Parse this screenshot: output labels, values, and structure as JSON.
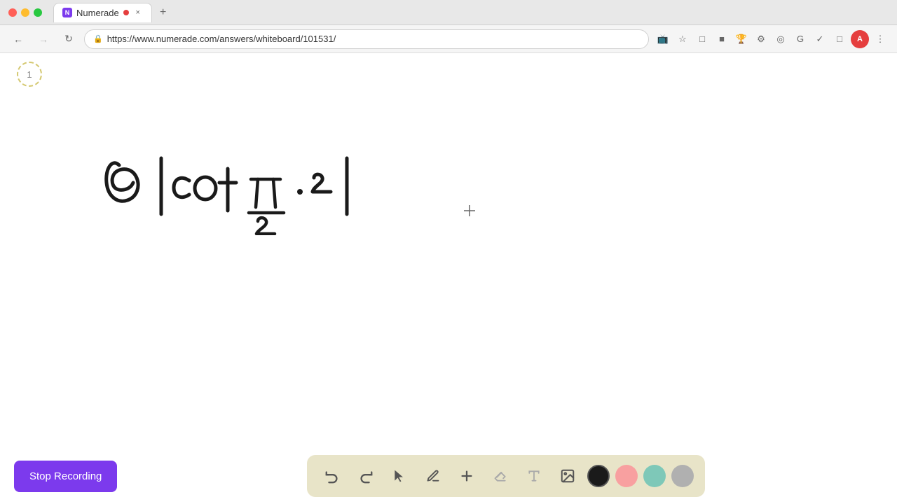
{
  "browser": {
    "tab_title": "Numerade",
    "tab_favicon": "N",
    "url": "https://www.numerade.com/answers/whiteboard/101531/",
    "recording_dot": true
  },
  "page": {
    "number": "1"
  },
  "toolbar": {
    "stop_recording_label": "Stop Recording",
    "tools": [
      {
        "id": "undo",
        "icon": "↩",
        "label": "Undo"
      },
      {
        "id": "redo",
        "icon": "↪",
        "label": "Redo"
      },
      {
        "id": "select",
        "icon": "▲",
        "label": "Select"
      },
      {
        "id": "pen",
        "icon": "✏",
        "label": "Pen"
      },
      {
        "id": "add",
        "icon": "+",
        "label": "Add"
      },
      {
        "id": "eraser",
        "icon": "/",
        "label": "Eraser"
      },
      {
        "id": "text",
        "icon": "A",
        "label": "Text"
      },
      {
        "id": "image",
        "icon": "🖼",
        "label": "Image"
      }
    ],
    "colors": [
      {
        "id": "black",
        "value": "#1a1a1a",
        "active": true
      },
      {
        "id": "pink",
        "value": "#f8a0a0",
        "active": false
      },
      {
        "id": "teal",
        "value": "#7ec8b8",
        "active": false
      },
      {
        "id": "gray",
        "value": "#b0b0b0",
        "active": false
      }
    ]
  },
  "whiteboard": {
    "math_expression": "6 |cot π/2 · 2|"
  }
}
